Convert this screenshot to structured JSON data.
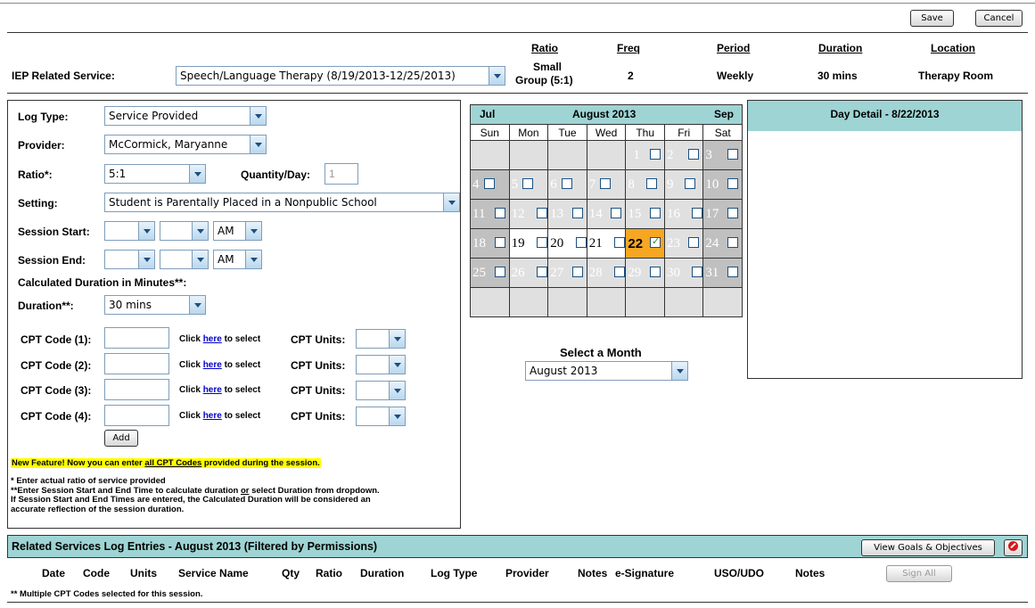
{
  "toolbar": {
    "save_label": "Save",
    "cancel_label": "Cancel"
  },
  "service_header": {
    "label": "IEP Related Service:",
    "selected": "Speech/Language Therapy (8/19/2013-12/25/2013)",
    "columns": {
      "ratio": {
        "header": "Ratio",
        "value_line1": "Small",
        "value_line2": "Group (5:1)"
      },
      "freq": {
        "header": "Freq",
        "value": "2"
      },
      "period": {
        "header": "Period",
        "value": "Weekly"
      },
      "duration": {
        "header": "Duration",
        "value": "30 mins"
      },
      "location": {
        "header": "Location",
        "value": "Therapy Room"
      }
    }
  },
  "form": {
    "log_type": {
      "label": "Log Type:",
      "value": "Service Provided"
    },
    "provider": {
      "label": "Provider:",
      "value": "McCormick, Maryanne"
    },
    "ratio": {
      "label": "Ratio*:",
      "value": "5:1"
    },
    "quantity": {
      "label": "Quantity/Day:",
      "value": "1"
    },
    "setting": {
      "label": "Setting:",
      "value": "Student is Parentally Placed in a Nonpublic School"
    },
    "session_start": {
      "label": "Session Start:",
      "ampm": "AM"
    },
    "session_end": {
      "label": "Session End:",
      "ampm": "AM"
    },
    "calc_duration_label": "Calculated Duration in Minutes**:",
    "duration": {
      "label": "Duration**:",
      "value": "30 mins"
    },
    "cpt": [
      {
        "label": "CPT Code (1):"
      },
      {
        "label": "CPT Code (2):"
      },
      {
        "label": "CPT Code (3):"
      },
      {
        "label": "CPT Code (4):"
      }
    ],
    "click_prefix": "Click ",
    "click_link": "here",
    "click_suffix": " to select",
    "cpt_units_label": "CPT Units:",
    "add_label": "Add",
    "new_feature_prefix": "New Feature! Now you can enter ",
    "new_feature_link": "all CPT Codes",
    "new_feature_suffix": " provided during the session.",
    "note1": "* Enter actual ratio of service provided",
    "note2a": "**Enter Session Start and End Time to calculate duration ",
    "note2b": "or",
    "note2c": " select Duration from dropdown.",
    "note3": "If Session Start and End Times are entered, the Calculated Duration will be considered an",
    "note4": "accurate reflection of the session duration."
  },
  "calendar": {
    "prev": "Jul",
    "title": "August 2013",
    "next": "Sep",
    "days": [
      "Sun",
      "Mon",
      "Tue",
      "Wed",
      "Thu",
      "Fri",
      "Sat"
    ],
    "select_month_label": "Select a Month",
    "select_month_value": "August 2013"
  },
  "day_detail": {
    "title": "Day Detail - 8/22/2013"
  },
  "log": {
    "title": "Related Services Log Entries - August 2013 (Filtered by Permissions)",
    "view_goals_label": "View Goals & Objectives",
    "columns": [
      "Date",
      "Code",
      "Units",
      "Service Name",
      "Qty",
      "Ratio",
      "Duration",
      "Log Type",
      "Provider",
      "Notes",
      "e-Signature",
      "USO/UDO",
      "Notes"
    ],
    "sign_all_label": "Sign All",
    "footnote": "** Multiple CPT Codes selected for this session."
  },
  "colors": {
    "accent": "#9fd4d4",
    "highlight": "#ffff00",
    "selected_day": "#f5a623"
  }
}
